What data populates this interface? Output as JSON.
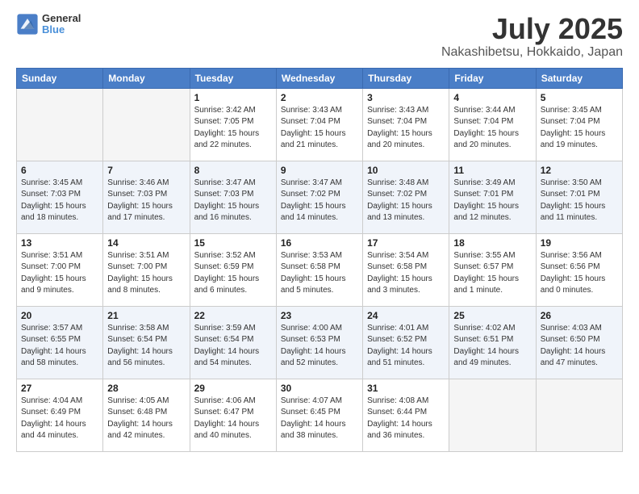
{
  "header": {
    "logo_line1": "General",
    "logo_line2": "Blue",
    "title": "July 2025",
    "subtitle": "Nakashibetsu, Hokkaido, Japan"
  },
  "days_of_week": [
    "Sunday",
    "Monday",
    "Tuesday",
    "Wednesday",
    "Thursday",
    "Friday",
    "Saturday"
  ],
  "weeks": [
    [
      {
        "day": "",
        "info": ""
      },
      {
        "day": "",
        "info": ""
      },
      {
        "day": "1",
        "info": "Sunrise: 3:42 AM\nSunset: 7:05 PM\nDaylight: 15 hours\nand 22 minutes."
      },
      {
        "day": "2",
        "info": "Sunrise: 3:43 AM\nSunset: 7:04 PM\nDaylight: 15 hours\nand 21 minutes."
      },
      {
        "day": "3",
        "info": "Sunrise: 3:43 AM\nSunset: 7:04 PM\nDaylight: 15 hours\nand 20 minutes."
      },
      {
        "day": "4",
        "info": "Sunrise: 3:44 AM\nSunset: 7:04 PM\nDaylight: 15 hours\nand 20 minutes."
      },
      {
        "day": "5",
        "info": "Sunrise: 3:45 AM\nSunset: 7:04 PM\nDaylight: 15 hours\nand 19 minutes."
      }
    ],
    [
      {
        "day": "6",
        "info": "Sunrise: 3:45 AM\nSunset: 7:03 PM\nDaylight: 15 hours\nand 18 minutes."
      },
      {
        "day": "7",
        "info": "Sunrise: 3:46 AM\nSunset: 7:03 PM\nDaylight: 15 hours\nand 17 minutes."
      },
      {
        "day": "8",
        "info": "Sunrise: 3:47 AM\nSunset: 7:03 PM\nDaylight: 15 hours\nand 16 minutes."
      },
      {
        "day": "9",
        "info": "Sunrise: 3:47 AM\nSunset: 7:02 PM\nDaylight: 15 hours\nand 14 minutes."
      },
      {
        "day": "10",
        "info": "Sunrise: 3:48 AM\nSunset: 7:02 PM\nDaylight: 15 hours\nand 13 minutes."
      },
      {
        "day": "11",
        "info": "Sunrise: 3:49 AM\nSunset: 7:01 PM\nDaylight: 15 hours\nand 12 minutes."
      },
      {
        "day": "12",
        "info": "Sunrise: 3:50 AM\nSunset: 7:01 PM\nDaylight: 15 hours\nand 11 minutes."
      }
    ],
    [
      {
        "day": "13",
        "info": "Sunrise: 3:51 AM\nSunset: 7:00 PM\nDaylight: 15 hours\nand 9 minutes."
      },
      {
        "day": "14",
        "info": "Sunrise: 3:51 AM\nSunset: 7:00 PM\nDaylight: 15 hours\nand 8 minutes."
      },
      {
        "day": "15",
        "info": "Sunrise: 3:52 AM\nSunset: 6:59 PM\nDaylight: 15 hours\nand 6 minutes."
      },
      {
        "day": "16",
        "info": "Sunrise: 3:53 AM\nSunset: 6:58 PM\nDaylight: 15 hours\nand 5 minutes."
      },
      {
        "day": "17",
        "info": "Sunrise: 3:54 AM\nSunset: 6:58 PM\nDaylight: 15 hours\nand 3 minutes."
      },
      {
        "day": "18",
        "info": "Sunrise: 3:55 AM\nSunset: 6:57 PM\nDaylight: 15 hours\nand 1 minute."
      },
      {
        "day": "19",
        "info": "Sunrise: 3:56 AM\nSunset: 6:56 PM\nDaylight: 15 hours\nand 0 minutes."
      }
    ],
    [
      {
        "day": "20",
        "info": "Sunrise: 3:57 AM\nSunset: 6:55 PM\nDaylight: 14 hours\nand 58 minutes."
      },
      {
        "day": "21",
        "info": "Sunrise: 3:58 AM\nSunset: 6:54 PM\nDaylight: 14 hours\nand 56 minutes."
      },
      {
        "day": "22",
        "info": "Sunrise: 3:59 AM\nSunset: 6:54 PM\nDaylight: 14 hours\nand 54 minutes."
      },
      {
        "day": "23",
        "info": "Sunrise: 4:00 AM\nSunset: 6:53 PM\nDaylight: 14 hours\nand 52 minutes."
      },
      {
        "day": "24",
        "info": "Sunrise: 4:01 AM\nSunset: 6:52 PM\nDaylight: 14 hours\nand 51 minutes."
      },
      {
        "day": "25",
        "info": "Sunrise: 4:02 AM\nSunset: 6:51 PM\nDaylight: 14 hours\nand 49 minutes."
      },
      {
        "day": "26",
        "info": "Sunrise: 4:03 AM\nSunset: 6:50 PM\nDaylight: 14 hours\nand 47 minutes."
      }
    ],
    [
      {
        "day": "27",
        "info": "Sunrise: 4:04 AM\nSunset: 6:49 PM\nDaylight: 14 hours\nand 44 minutes."
      },
      {
        "day": "28",
        "info": "Sunrise: 4:05 AM\nSunset: 6:48 PM\nDaylight: 14 hours\nand 42 minutes."
      },
      {
        "day": "29",
        "info": "Sunrise: 4:06 AM\nSunset: 6:47 PM\nDaylight: 14 hours\nand 40 minutes."
      },
      {
        "day": "30",
        "info": "Sunrise: 4:07 AM\nSunset: 6:45 PM\nDaylight: 14 hours\nand 38 minutes."
      },
      {
        "day": "31",
        "info": "Sunrise: 4:08 AM\nSunset: 6:44 PM\nDaylight: 14 hours\nand 36 minutes."
      },
      {
        "day": "",
        "info": ""
      },
      {
        "day": "",
        "info": ""
      }
    ]
  ]
}
